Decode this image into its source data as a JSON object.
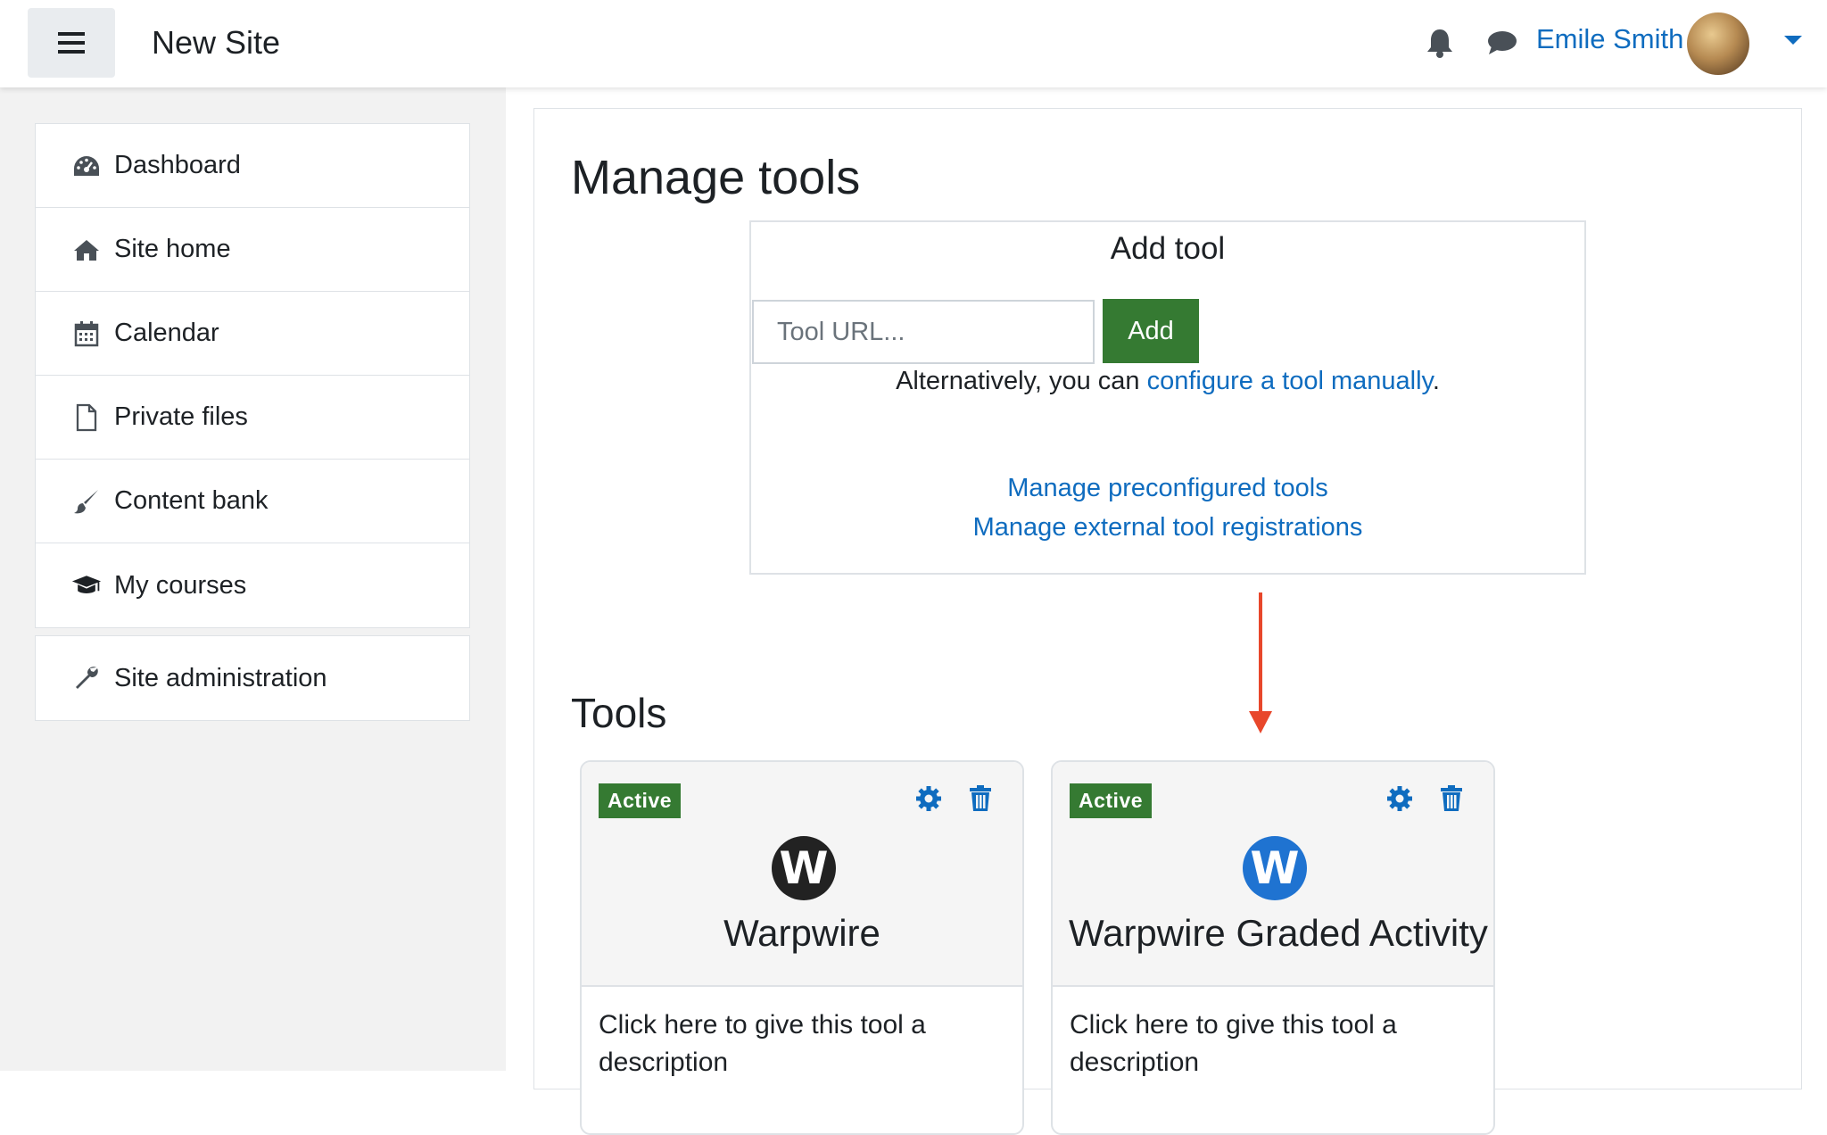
{
  "navbar": {
    "site_name": "New Site",
    "user_name": "Emile Smith",
    "icons": [
      "hamburger-icon",
      "bell-icon",
      "chat-icon",
      "chevron-down-icon"
    ]
  },
  "drawer": {
    "items": [
      {
        "label": "Dashboard",
        "icon": "dashboard-icon"
      },
      {
        "label": "Site home",
        "icon": "home-icon"
      },
      {
        "label": "Calendar",
        "icon": "calendar-icon"
      },
      {
        "label": "Private files",
        "icon": "file-icon"
      },
      {
        "label": "Content bank",
        "icon": "brush-icon"
      },
      {
        "label": "My courses",
        "icon": "graduation-cap-icon"
      }
    ],
    "admin": {
      "label": "Site administration",
      "icon": "wrench-icon"
    }
  },
  "main": {
    "title": "Manage tools",
    "add_tool": {
      "legend": "Add tool",
      "url_placeholder": "Tool URL...",
      "add_label": "Add",
      "alt_prefix": "Alternatively, you can ",
      "alt_link": "configure a tool manually",
      "alt_suffix": ".",
      "preconfigured_link": "Manage preconfigured tools",
      "registrations_link": "Manage external tool registrations"
    },
    "tools_heading": "Tools",
    "tools": [
      {
        "status": "Active",
        "name": "Warpwire",
        "description": "Click here to give this tool a description",
        "logo_letter": "W",
        "logo_color": "#222222"
      },
      {
        "status": "Active",
        "name": "Warpwire Graded Activity",
        "description": "Click here to give this tool a description",
        "logo_letter": "W",
        "logo_color": "#1f73d1"
      }
    ]
  },
  "colors": {
    "link": "#0f6cbf",
    "success": "#357a32",
    "annotation_arrow": "#e8472b"
  }
}
